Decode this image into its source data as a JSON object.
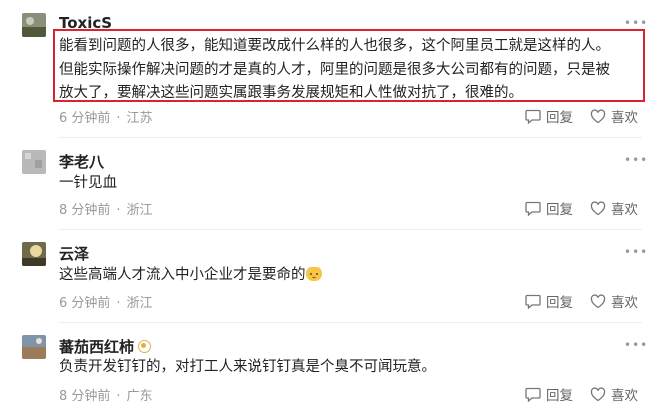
{
  "comments": [
    {
      "username": "ToxicS",
      "content_lines": [
        "能看到问题的人很多，能知道要改成什么样的人也很多，这个阿里员工就是这样的人。",
        "但能实际操作解决问题的才是真的人才，阿里的问题是很多大公司都有的问题，只是被",
        "放大了，要解决这些问题实属跟事务发展规矩和人性做对抗了，很难的。"
      ],
      "time": "6 分钟前",
      "location": "江苏",
      "reply_label": "回复",
      "like_label": "喜欢"
    },
    {
      "username": "李老八",
      "content_lines": [
        "一针见血"
      ],
      "time": "8 分钟前",
      "location": "浙江",
      "reply_label": "回复",
      "like_label": "喜欢"
    },
    {
      "username": "云泽",
      "content_lines": [
        "这些高端人才流入中小企业才是要命的"
      ],
      "time": "6 分钟前",
      "location": "浙江",
      "reply_label": "回复",
      "like_label": "喜欢"
    },
    {
      "username": "蕃茄西红柿",
      "content_lines": [
        "负责开发钉钉的，对打工人来说钉钉真是个臭不可闻玩意。"
      ],
      "time": "8 分钟前",
      "location": "广东",
      "reply_label": "回复",
      "like_label": "喜欢"
    }
  ],
  "more_label": "•••",
  "separator": "·",
  "colors": {
    "highlight_border": "#d9232f",
    "meta_text": "#999999",
    "username": "#222222"
  },
  "icons": {
    "reply": "comment-bubble-icon",
    "like": "heart-icon",
    "emoji": "cat-face-emoji-icon",
    "badge": "gold-badge-icon"
  }
}
